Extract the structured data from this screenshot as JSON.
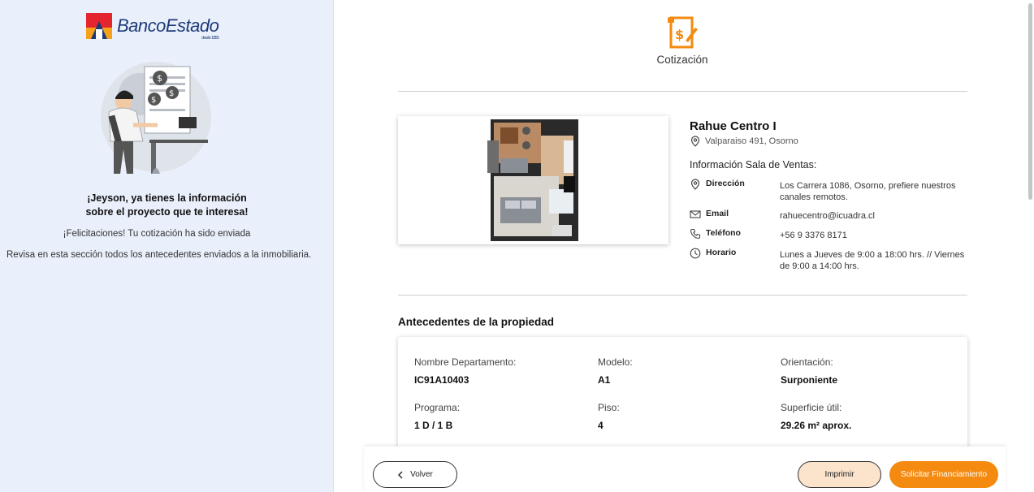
{
  "left": {
    "brand": "BancoEstado",
    "brand_sub": "desde 1855",
    "heading_line1": "¡Jeyson, ya tienes la información",
    "heading_line2": "sobre el proyecto que te interesa!",
    "message1": "¡Felicitaciones! Tu cotización ha sido enviada",
    "message2": "Revisa en esta sección todos los antecedentes enviados a la inmobiliaria."
  },
  "header": {
    "title": "Cotización",
    "icon": "quote-document-icon"
  },
  "project": {
    "name": "Rahue Centro I",
    "address": "Valparaiso 491, Osorno",
    "sales_title": "Información Sala de Ventas:",
    "rows": [
      {
        "icon": "location-pin-icon",
        "label": "Dirección",
        "value": "Los Carrera 1086, Osorno, prefiere nuestros canales remotos."
      },
      {
        "icon": "envelope-icon",
        "label": "Email",
        "value": "rahuecentro@icuadra.cl"
      },
      {
        "icon": "phone-icon",
        "label": "Teléfono",
        "value": "+56 9 3376 8171"
      },
      {
        "icon": "clock-icon",
        "label": "Horario",
        "value": "Lunes a Jueves de 9:00 a 18:00 hrs. // Viernes de 9:00 a 14:00 hrs."
      }
    ]
  },
  "antecedentes": {
    "title": "Antecedentes de la propiedad",
    "fields": [
      {
        "label": "Nombre Departamento:",
        "value": "IC91A10403"
      },
      {
        "label": "Modelo:",
        "value": "A1"
      },
      {
        "label": "Orientación:",
        "value": "Surponiente"
      },
      {
        "label": "Programa:",
        "value": "1 D / 1 B"
      },
      {
        "label": "Piso:",
        "value": "4"
      },
      {
        "label": "Superficie útil:",
        "value": "29.26 m² aprox."
      }
    ]
  },
  "actions": {
    "back": "Volver",
    "print": "Imprimir",
    "request": "Solicitar Financiamiento"
  },
  "colors": {
    "accent": "#f48a10",
    "print_bg": "#fbe3cc",
    "left_bg": "#eaf0fb",
    "brand_blue": "#1b3a7a"
  }
}
